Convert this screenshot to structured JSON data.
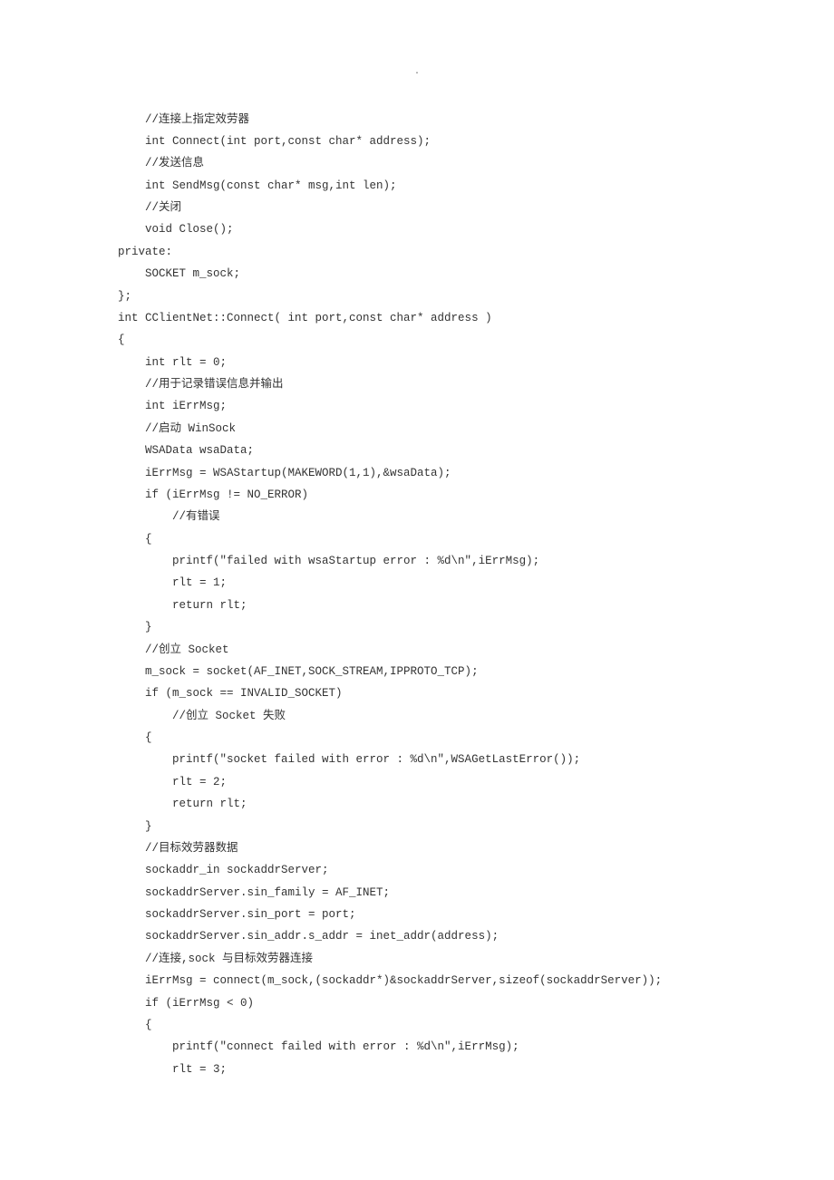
{
  "dot": ".",
  "lines": [
    "    //连接上指定效劳器",
    "    int Connect(int port,const char* address);",
    "    //发送信息",
    "    int SendMsg(const char* msg,int len);",
    "    //关闭",
    "    void Close();",
    "private:",
    "    SOCKET m_sock;",
    "};",
    "int CClientNet::Connect( int port,const char* address )",
    "{",
    "    int rlt = 0;",
    "    //用于记录错误信息并输出",
    "    int iErrMsg;",
    "    //启动 WinSock",
    "    WSAData wsaData;",
    "    iErrMsg = WSAStartup(MAKEWORD(1,1),&wsaData);",
    "    if (iErrMsg != NO_ERROR)",
    "        //有错误",
    "    {",
    "        printf(\"failed with wsaStartup error : %d\\n\",iErrMsg);",
    "        rlt = 1;",
    "        return rlt;",
    "    }",
    "    //创立 Socket",
    "    m_sock = socket(AF_INET,SOCK_STREAM,IPPROTO_TCP);",
    "    if (m_sock == INVALID_SOCKET)",
    "        //创立 Socket 失败",
    "    {",
    "        printf(\"socket failed with error : %d\\n\",WSAGetLastError());",
    "        rlt = 2;",
    "        return rlt;",
    "    }",
    "    //目标效劳器数据",
    "    sockaddr_in sockaddrServer;",
    "    sockaddrServer.sin_family = AF_INET;",
    "    sockaddrServer.sin_port = port;",
    "    sockaddrServer.sin_addr.s_addr = inet_addr(address);",
    "    //连接,sock 与目标效劳器连接",
    "    iErrMsg = connect(m_sock,(sockaddr*)&sockaddrServer,sizeof(sockaddrServer));",
    "    if (iErrMsg < 0)",
    "    {",
    "        printf(\"connect failed with error : %d\\n\",iErrMsg);",
    "        rlt = 3;"
  ]
}
